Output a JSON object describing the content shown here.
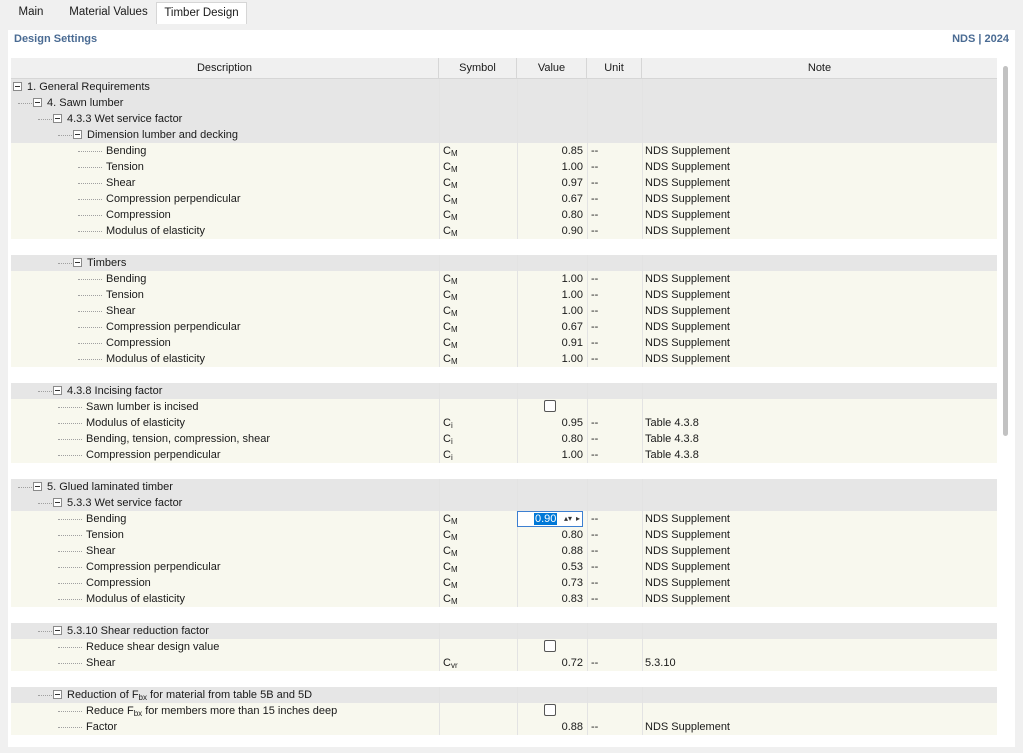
{
  "tabs": [
    {
      "label": "Main",
      "active": false
    },
    {
      "label": "Material Values",
      "active": false
    },
    {
      "label": "Timber Design",
      "active": true
    }
  ],
  "panel": {
    "title": "Design Settings",
    "standard": "NDS | 2024"
  },
  "columns": {
    "description": "Description",
    "symbol": "Symbol",
    "value": "Value",
    "unit": "Unit",
    "note": "Note"
  },
  "rows": [
    {
      "type": "section",
      "level": 0,
      "label": "1. General Requirements"
    },
    {
      "type": "section",
      "level": 1,
      "label": "4. Sawn lumber"
    },
    {
      "type": "section",
      "level": 2,
      "label": "4.3.3 Wet service factor"
    },
    {
      "type": "section",
      "level": 3,
      "label": "Dimension lumber and decking"
    },
    {
      "type": "leaf",
      "level": 4,
      "label": "Bending",
      "sym": "C",
      "sub": "M",
      "value": "0.85",
      "unit": "--",
      "note": "NDS Supplement"
    },
    {
      "type": "leaf",
      "level": 4,
      "label": "Tension",
      "sym": "C",
      "sub": "M",
      "value": "1.00",
      "unit": "--",
      "note": "NDS Supplement"
    },
    {
      "type": "leaf",
      "level": 4,
      "label": "Shear",
      "sym": "C",
      "sub": "M",
      "value": "0.97",
      "unit": "--",
      "note": "NDS Supplement"
    },
    {
      "type": "leaf",
      "level": 4,
      "label": "Compression perpendicular",
      "sym": "C",
      "sub": "M",
      "value": "0.67",
      "unit": "--",
      "note": "NDS Supplement"
    },
    {
      "type": "leaf",
      "level": 4,
      "label": "Compression",
      "sym": "C",
      "sub": "M",
      "value": "0.80",
      "unit": "--",
      "note": "NDS Supplement"
    },
    {
      "type": "leaf",
      "level": 4,
      "label": "Modulus of elasticity",
      "sym": "C",
      "sub": "M",
      "value": "0.90",
      "unit": "--",
      "note": "NDS Supplement"
    },
    {
      "type": "spacer"
    },
    {
      "type": "section",
      "level": 3,
      "label": "Timbers"
    },
    {
      "type": "leaf",
      "level": 4,
      "label": "Bending",
      "sym": "C",
      "sub": "M",
      "value": "1.00",
      "unit": "--",
      "note": "NDS Supplement"
    },
    {
      "type": "leaf",
      "level": 4,
      "label": "Tension",
      "sym": "C",
      "sub": "M",
      "value": "1.00",
      "unit": "--",
      "note": "NDS Supplement"
    },
    {
      "type": "leaf",
      "level": 4,
      "label": "Shear",
      "sym": "C",
      "sub": "M",
      "value": "1.00",
      "unit": "--",
      "note": "NDS Supplement"
    },
    {
      "type": "leaf",
      "level": 4,
      "label": "Compression perpendicular",
      "sym": "C",
      "sub": "M",
      "value": "0.67",
      "unit": "--",
      "note": "NDS Supplement"
    },
    {
      "type": "leaf",
      "level": 4,
      "label": "Compression",
      "sym": "C",
      "sub": "M",
      "value": "0.91",
      "unit": "--",
      "note": "NDS Supplement"
    },
    {
      "type": "leaf",
      "level": 4,
      "label": "Modulus of elasticity",
      "sym": "C",
      "sub": "M",
      "value": "1.00",
      "unit": "--",
      "note": "NDS Supplement"
    },
    {
      "type": "spacer"
    },
    {
      "type": "section",
      "level": 2,
      "label": "4.3.8 Incising factor"
    },
    {
      "type": "leaf",
      "level": 3,
      "label": "Sawn lumber is incised",
      "checkbox": true,
      "checked": false
    },
    {
      "type": "leaf",
      "level": 3,
      "label": "Modulus of elasticity",
      "sym": "C",
      "sub": "i",
      "value": "0.95",
      "unit": "--",
      "note": "Table 4.3.8"
    },
    {
      "type": "leaf",
      "level": 3,
      "label": "Bending, tension, compression, shear",
      "sym": "C",
      "sub": "i",
      "value": "0.80",
      "unit": "--",
      "note": "Table 4.3.8"
    },
    {
      "type": "leaf",
      "level": 3,
      "label": "Compression perpendicular",
      "sym": "C",
      "sub": "i",
      "value": "1.00",
      "unit": "--",
      "note": "Table 4.3.8"
    },
    {
      "type": "spacer"
    },
    {
      "type": "section",
      "level": 1,
      "label": "5. Glued laminated timber"
    },
    {
      "type": "section",
      "level": 2,
      "label": "5.3.3 Wet service factor"
    },
    {
      "type": "leaf",
      "level": 3,
      "label": "Bending",
      "sym": "C",
      "sub": "M",
      "value": "0.90",
      "unit": "--",
      "note": "NDS Supplement",
      "editing": true
    },
    {
      "type": "leaf",
      "level": 3,
      "label": "Tension",
      "sym": "C",
      "sub": "M",
      "value": "0.80",
      "unit": "--",
      "note": "NDS Supplement"
    },
    {
      "type": "leaf",
      "level": 3,
      "label": "Shear",
      "sym": "C",
      "sub": "M",
      "value": "0.88",
      "unit": "--",
      "note": "NDS Supplement"
    },
    {
      "type": "leaf",
      "level": 3,
      "label": "Compression perpendicular",
      "sym": "C",
      "sub": "M",
      "value": "0.53",
      "unit": "--",
      "note": "NDS Supplement"
    },
    {
      "type": "leaf",
      "level": 3,
      "label": "Compression",
      "sym": "C",
      "sub": "M",
      "value": "0.73",
      "unit": "--",
      "note": "NDS Supplement"
    },
    {
      "type": "leaf",
      "level": 3,
      "label": "Modulus of elasticity",
      "sym": "C",
      "sub": "M",
      "value": "0.83",
      "unit": "--",
      "note": "NDS Supplement"
    },
    {
      "type": "spacer"
    },
    {
      "type": "section",
      "level": 2,
      "label": "5.3.10 Shear reduction factor"
    },
    {
      "type": "leaf",
      "level": 3,
      "label": "Reduce shear design value",
      "checkbox": true,
      "checked": false
    },
    {
      "type": "leaf",
      "level": 3,
      "label": "Shear",
      "sym": "C",
      "sub": "vr",
      "value": "0.72",
      "unit": "--",
      "note": "5.3.10"
    },
    {
      "type": "spacer"
    },
    {
      "type": "section",
      "level": 2,
      "label": "Reduction of F",
      "label_sub": "bx",
      "label_tail": " for material from table 5B and 5D"
    },
    {
      "type": "leaf",
      "level": 3,
      "label": "Reduce F",
      "label_sub": "bx",
      "label_tail": " for members more than 15 inches deep",
      "checkbox": true,
      "checked": false
    },
    {
      "type": "leaf",
      "level": 3,
      "label": "Factor",
      "value": "0.88",
      "unit": "--",
      "note": "NDS Supplement"
    }
  ]
}
